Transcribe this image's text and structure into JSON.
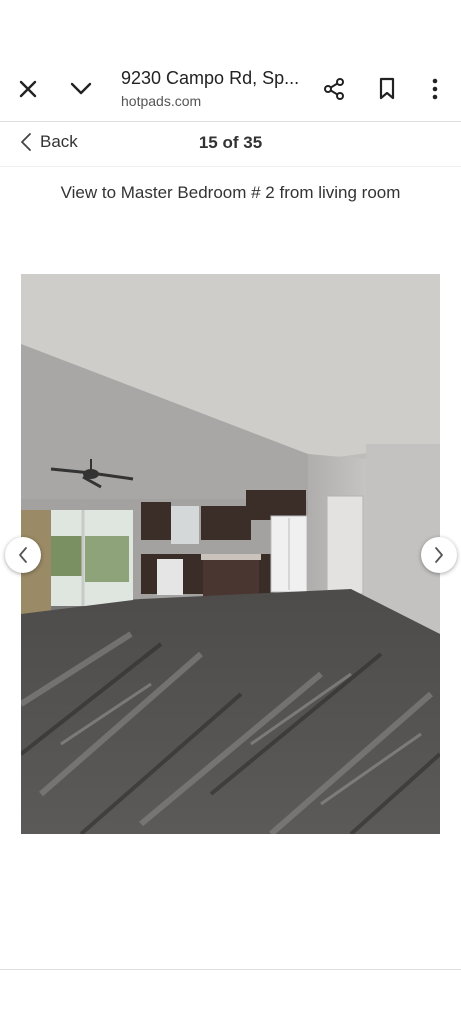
{
  "header": {
    "title": "9230 Campo Rd, Sp...",
    "domain": "hotpads.com",
    "close_icon": "close-icon",
    "collapse_icon": "chevron-down-icon",
    "share_icon": "share-icon",
    "bookmark_icon": "bookmark-icon",
    "menu_icon": "more-vertical-icon"
  },
  "gallery": {
    "back_label": "Back",
    "counter": "15 of 35",
    "caption": "View to Master Bedroom # 2 from living room",
    "prev_icon": "chevron-left-icon",
    "next_icon": "chevron-right-icon"
  }
}
